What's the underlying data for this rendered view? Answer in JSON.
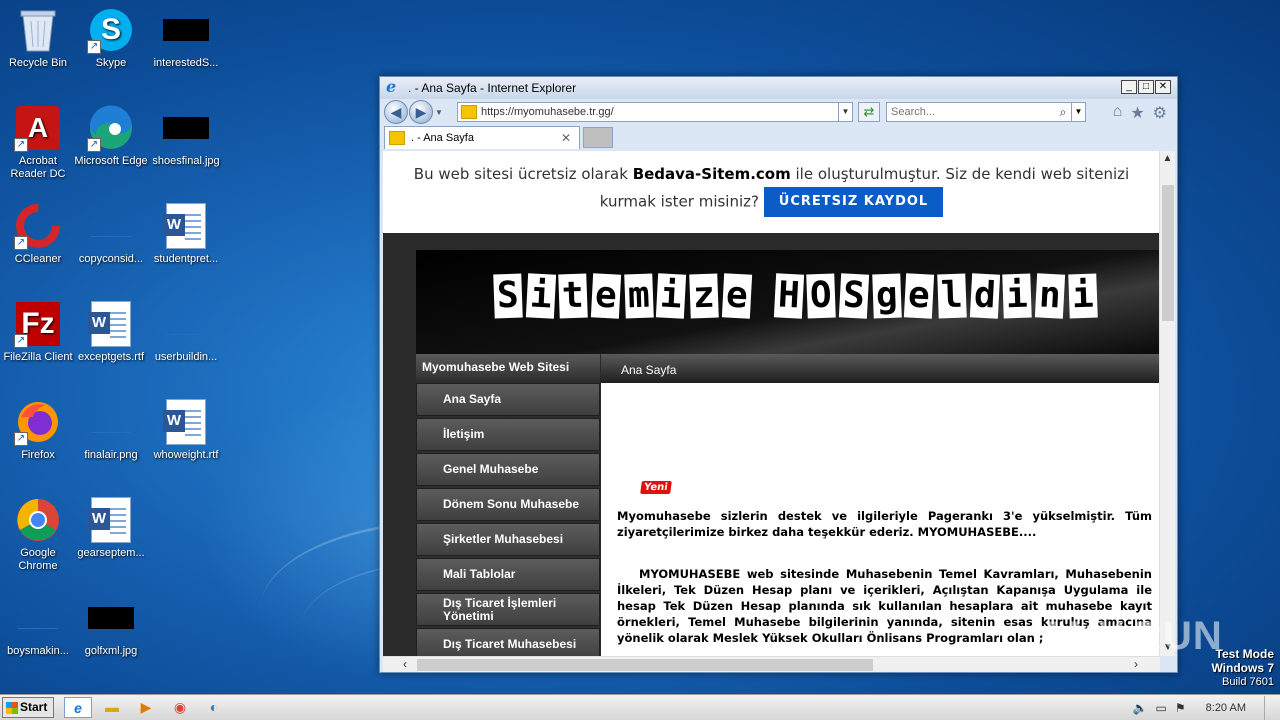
{
  "desktop": {
    "icons": [
      {
        "label": "Recycle Bin",
        "icon": "recycle-bin-icon"
      },
      {
        "label": "Skype",
        "icon": "skype-icon"
      },
      {
        "label": "interestedS...",
        "icon": "black-thumbnail-icon"
      },
      {
        "label": "Acrobat Reader DC",
        "icon": "acrobat-icon"
      },
      {
        "label": "Microsoft Edge",
        "icon": "edge-icon"
      },
      {
        "label": "shoesfinal.jpg",
        "icon": "black-thumbnail-icon"
      },
      {
        "label": "CCleaner",
        "icon": "ccleaner-icon"
      },
      {
        "label": "copyconsid...",
        "icon": "blank-file-icon"
      },
      {
        "label": "studentpret...",
        "icon": "word-doc-icon"
      },
      {
        "label": "FileZilla Client",
        "icon": "filezilla-icon"
      },
      {
        "label": "exceptgets.rtf",
        "icon": "word-doc-icon"
      },
      {
        "label": "userbuildin...",
        "icon": "blank-file-icon"
      },
      {
        "label": "Firefox",
        "icon": "firefox-icon"
      },
      {
        "label": "finalair.png",
        "icon": "blank-file-icon"
      },
      {
        "label": "whoweight.rtf",
        "icon": "word-doc-icon"
      },
      {
        "label": "Google Chrome",
        "icon": "chrome-icon"
      },
      {
        "label": "gearseptem...",
        "icon": "word-doc-icon"
      },
      {
        "label": "boysmakin...",
        "icon": "blank-file-icon"
      },
      {
        "label": "golfxml.jpg",
        "icon": "black-thumbnail-icon"
      }
    ]
  },
  "browser": {
    "window_title": ". - Ana Sayfa - Internet Explorer",
    "address": "https://myomuhasebe.tr.gg/",
    "search_placeholder": "Search...",
    "tab_label": ". - Ana Sayfa",
    "window_buttons": {
      "minimize": "_",
      "maximize": "□",
      "close": "✕"
    }
  },
  "page": {
    "promo_text_1": "Bu web sitesi ücretsiz olarak",
    "promo_brand": "Bedava-Sitem.com",
    "promo_text_2": "ile oluşturulmuştur. Siz de kendi web sitenizi kurmak ister misiniz?",
    "promo_button": "ÜCRETSIZ KAYDOL",
    "header_title": "Sitemize HOSgeldini",
    "sidebar_title": "Myomuhasebe Web Sitesi",
    "sidebar_items": [
      "Ana Sayfa",
      "İletişim",
      "Genel Muhasebe",
      "Dönem Sonu Muhasebe",
      "Şirketler Muhasebesi",
      "Mali Tablolar",
      "Dış Ticaret İşlemleri Yönetimi",
      "Dış Ticaret Muhasebesi"
    ],
    "main_title": "Ana Sayfa",
    "badge": "Yeni",
    "paragraph_1": "Myomuhasebe sizlerin destek ve ilgileriyle Pagerankı 3'e yükselmiştir. Tüm ziyaretçilerimize birkez daha teşekkür ederiz. MYOMUHASEBE....",
    "paragraph_2": "MYOMUHASEBE web sitesinde Muhasebenin Temel Kavramları, Muhasebenin İlkeleri, Tek Düzen Hesap planı ve içerikleri, Açılıştan Kapanışa Uygulama ile hesap Tek Düzen Hesap planında sık kullanılan hesaplara ait muhasebe kayıt örnekleri, Temel Muhasebe bilgilerinin yanında, sitenin esas kuruluş amacına yönelik olarak Meslek Yüksek Okulları Önlisans Programları olan ;"
  },
  "watermark": "ANY.RUN",
  "test_mode": {
    "line1": "Test Mode",
    "line2": "Windows 7",
    "line3": "Build 7601"
  },
  "taskbar": {
    "start_label": "Start",
    "clock": "8:20 AM"
  }
}
